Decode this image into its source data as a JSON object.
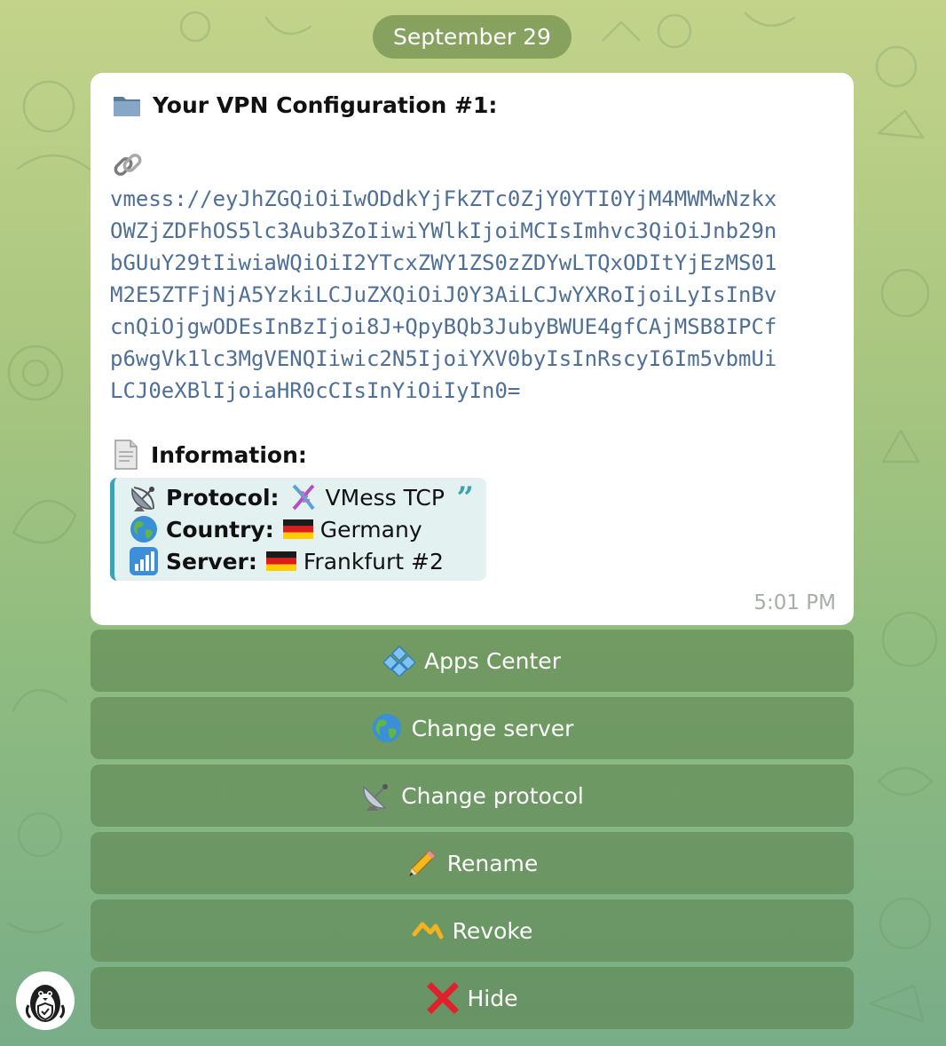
{
  "date_separator": "September 29",
  "message": {
    "title": "Your VPN Configuration #1:",
    "config_lines": [
      "vmess://eyJhZGQiOiIwODdkYjFkZTc0ZjY0YTI0YjM4MWMwNzkx",
      "OWZjZDFhOS5lc3Aub3ZoIiwiYWlkIjoiMCIsImhvc3QiOiJnb29n",
      "bGUuY29tIiwiaWQiOiI2YTcxZWY1ZS0zZDYwLTQxODItYjEzMS01",
      "M2E5ZTFjNjA5YzkiLCJuZXQiOiJ0Y3AiLCJwYXRoIjoiLyIsInBv",
      "cnQiOjgwODEsInBzIjoi8J+QpyBQb3JubyBWUE4gfCAjMSB8IPCf",
      "p6wgVk1lc3MgVENQIiwic2N5IjoiYXV0byIsInRscyI6Im5vbmUi",
      "LCJ0eXBlIjoiaHR0cCIsInYiOiIyIn0="
    ],
    "info_title": "Information:",
    "details": [
      {
        "label": "Protocol:",
        "value": "VMess TCP",
        "icon": "satellite-antenna-icon",
        "value_icon": "dna-icon"
      },
      {
        "label": "Country:",
        "value": "Germany",
        "icon": "globe-icon",
        "value_icon": "germany-flag-icon"
      },
      {
        "label": "Server:",
        "value": "Frankfurt #2",
        "icon": "signal-bars-icon",
        "value_icon": "germany-flag-icon"
      }
    ],
    "time": "5:01 PM"
  },
  "keyboard": [
    {
      "label": "Apps Center",
      "icon": "apps-diamond-icon"
    },
    {
      "label": "Change server",
      "icon": "globe-icon"
    },
    {
      "label": "Change protocol",
      "icon": "satellite-antenna-icon"
    },
    {
      "label": "Rename",
      "icon": "pencil-icon"
    },
    {
      "label": "Revoke",
      "icon": "revoke-chart-icon"
    },
    {
      "label": "Hide",
      "icon": "red-x-icon"
    }
  ],
  "colors": {
    "link_text": "#4f6f96",
    "quote_accent": "#3fa2b1",
    "quote_background": "#e3f1f1",
    "timestamp": "#a5b0a5"
  }
}
